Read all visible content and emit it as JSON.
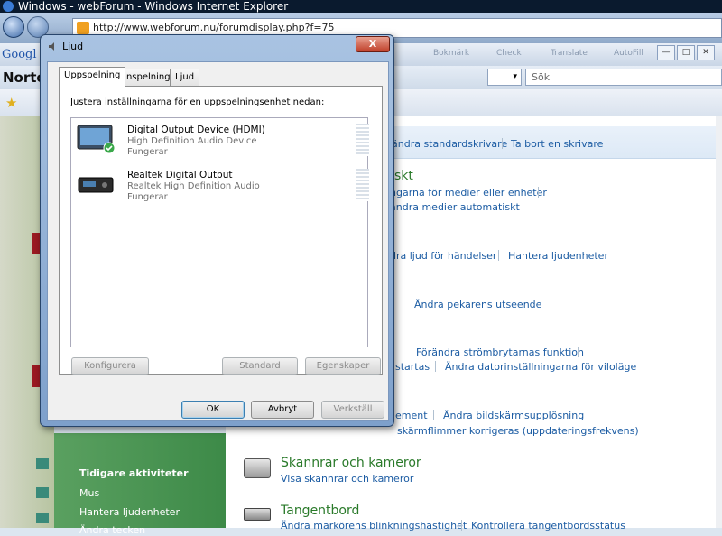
{
  "browser": {
    "window_title": "Windows - webForum - Windows Internet Explorer",
    "address": "http://www.webforum.nu/forumdisplay.php?f=75",
    "search_placeholder": "Sök",
    "google_label": "Googl",
    "norton_label": "Norto",
    "toolbar_items": [
      "Bokmärk",
      "Check",
      "Translate",
      "AutoFill"
    ]
  },
  "control_panel": {
    "links": {
      "change_default_printer": "ändra standardskrivare",
      "remove_printer": "Ta bort en skrivare",
      "media_settings": "ngarna för medier eller enheter",
      "media_auto": "ändra medier automatiskt",
      "sounds_events": "dra ljud för händelser",
      "manage_audio": "Hantera ljudenheter",
      "change_pointer": "Ändra pekarens utseende",
      "power_buttons": "Förändra strömbrytarnas funktion",
      "startas": "startas",
      "sleep_settings": "Ändra datorinställningarna för viloläge",
      "ement": "ement",
      "resolution": "Ändra bildskärmsupplösning",
      "refresh": "skärmflimmer korrigeras (uppdateringsfrekvens)",
      "view_scanners": "Visa skannrar och kameror",
      "cursor_blink": "Ändra markörens blinkningshastighet",
      "keyboard_status": "Kontrollera tangentbordsstatus"
    },
    "headings": {
      "hardware_partial": "skt",
      "scanners": "Skannrar och kameror",
      "keyboard": "Tangentbord"
    },
    "sidebar": {
      "title": "Tidigare aktiviteter",
      "items": [
        "Mus",
        "Hantera ljudenheter",
        "Ändra tecken"
      ]
    }
  },
  "dialog": {
    "title": "Ljud",
    "close_label": "X",
    "tabs": [
      "Uppspelning",
      "Inspelning",
      "Ljud"
    ],
    "instruction": "Justera inställningarna för en uppspelningsenhet nedan:",
    "devices": [
      {
        "name": "Digital Output Device (HDMI)",
        "driver": "High Definition Audio Device",
        "status": "Fungerar"
      },
      {
        "name": "Realtek Digital Output",
        "driver": "Realtek High Definition Audio",
        "status": "Fungerar"
      }
    ],
    "buttons": {
      "configure": "Konfigurera",
      "default": "Standard",
      "properties": "Egenskaper",
      "ok": "OK",
      "cancel": "Avbryt",
      "apply": "Verkställ"
    }
  }
}
